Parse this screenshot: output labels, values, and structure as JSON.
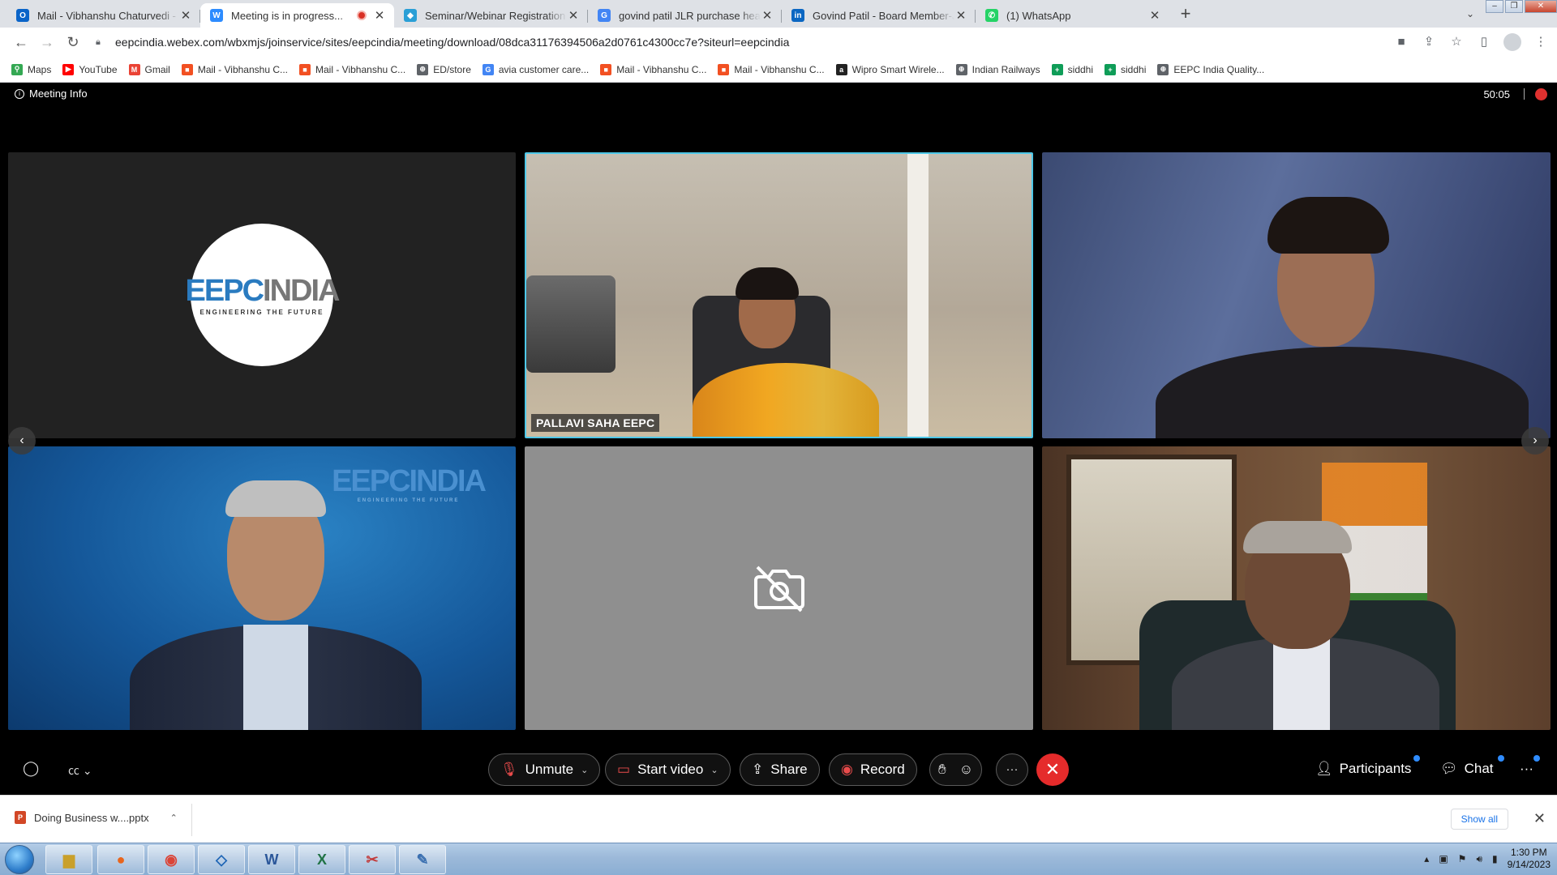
{
  "browser": {
    "tabs": [
      {
        "title": "Mail - Vibhanshu Chaturvedi - O",
        "icon": "outlook-icon",
        "color": "#0a64c8",
        "glyph": "O",
        "active": false
      },
      {
        "title": "Meeting is in progress...",
        "icon": "webex-icon",
        "color": "#2d8cff",
        "glyph": "W",
        "active": true
      },
      {
        "title": "Seminar/Webinar Registration Po",
        "icon": "diamond-icon",
        "color": "#2a9fd6",
        "glyph": "◆",
        "active": false
      },
      {
        "title": "govind patil JLR purchase head -",
        "icon": "google-icon",
        "color": "#4285f4",
        "glyph": "G",
        "active": false
      },
      {
        "title": "Govind Patil - Board Member-JLR",
        "icon": "linkedin-icon",
        "color": "#0a66c2",
        "glyph": "in",
        "active": false
      },
      {
        "title": "(1) WhatsApp",
        "icon": "whatsapp-icon",
        "color": "#25d366",
        "glyph": "✆",
        "active": false
      }
    ],
    "url": "eepcindia.webex.com/wbxmjs/joinservice/sites/eepcindia/meeting/download/08dca31176394506a2d0761c4300cc7e?siteurl=eepcindia",
    "bookmarks": [
      {
        "label": "Maps",
        "color": "#34a853",
        "glyph": "⚲"
      },
      {
        "label": "YouTube",
        "color": "#ff0000",
        "glyph": "▶"
      },
      {
        "label": "Gmail",
        "color": "#ea4335",
        "glyph": "M"
      },
      {
        "label": "Mail - Vibhanshu C...",
        "color": "#f25022",
        "glyph": "■"
      },
      {
        "label": "Mail - Vibhanshu C...",
        "color": "#f25022",
        "glyph": "■"
      },
      {
        "label": "ED/store",
        "color": "#5f6368",
        "glyph": "⊕"
      },
      {
        "label": "avia customer care...",
        "color": "#4285f4",
        "glyph": "G"
      },
      {
        "label": "Mail - Vibhanshu C...",
        "color": "#f25022",
        "glyph": "■"
      },
      {
        "label": "Mail - Vibhanshu C...",
        "color": "#f25022",
        "glyph": "■"
      },
      {
        "label": "Wipro Smart Wirele...",
        "color": "#222222",
        "glyph": "a"
      },
      {
        "label": "Indian Railways",
        "color": "#5f6368",
        "glyph": "⊕"
      },
      {
        "label": "siddhi",
        "color": "#0f9d58",
        "glyph": "+"
      },
      {
        "label": "siddhi",
        "color": "#0f9d58",
        "glyph": "+"
      },
      {
        "label": "EEPC India Quality...",
        "color": "#5f6368",
        "glyph": "⊕"
      }
    ]
  },
  "meeting": {
    "info_label": "Meeting Info",
    "timer": "50:05",
    "participants": [
      {
        "name": "",
        "type": "logo"
      },
      {
        "name": "PALLAVI SAHA EEPC",
        "type": "video",
        "active_speaker": true
      },
      {
        "name": "",
        "type": "video"
      },
      {
        "name": "",
        "type": "video"
      },
      {
        "name": "",
        "type": "camera-off"
      },
      {
        "name": "",
        "type": "video"
      }
    ],
    "logo": {
      "word_a": "EEPC",
      "word_b": "INDIA",
      "tagline": "ENGINEERING THE FUTURE"
    },
    "controls": {
      "unmute": "Unmute",
      "start_video": "Start video",
      "share": "Share",
      "record": "Record",
      "participants": "Participants",
      "chat": "Chat"
    },
    "colors": {
      "active_border": "#4ec8e8",
      "leave": "#e52b2b",
      "notify_dot": "#2f8cff"
    }
  },
  "downloads": {
    "file": "Doing Business w....pptx",
    "show_all": "Show all"
  },
  "taskbar": {
    "time": "1:30 PM",
    "date": "9/14/2023"
  }
}
